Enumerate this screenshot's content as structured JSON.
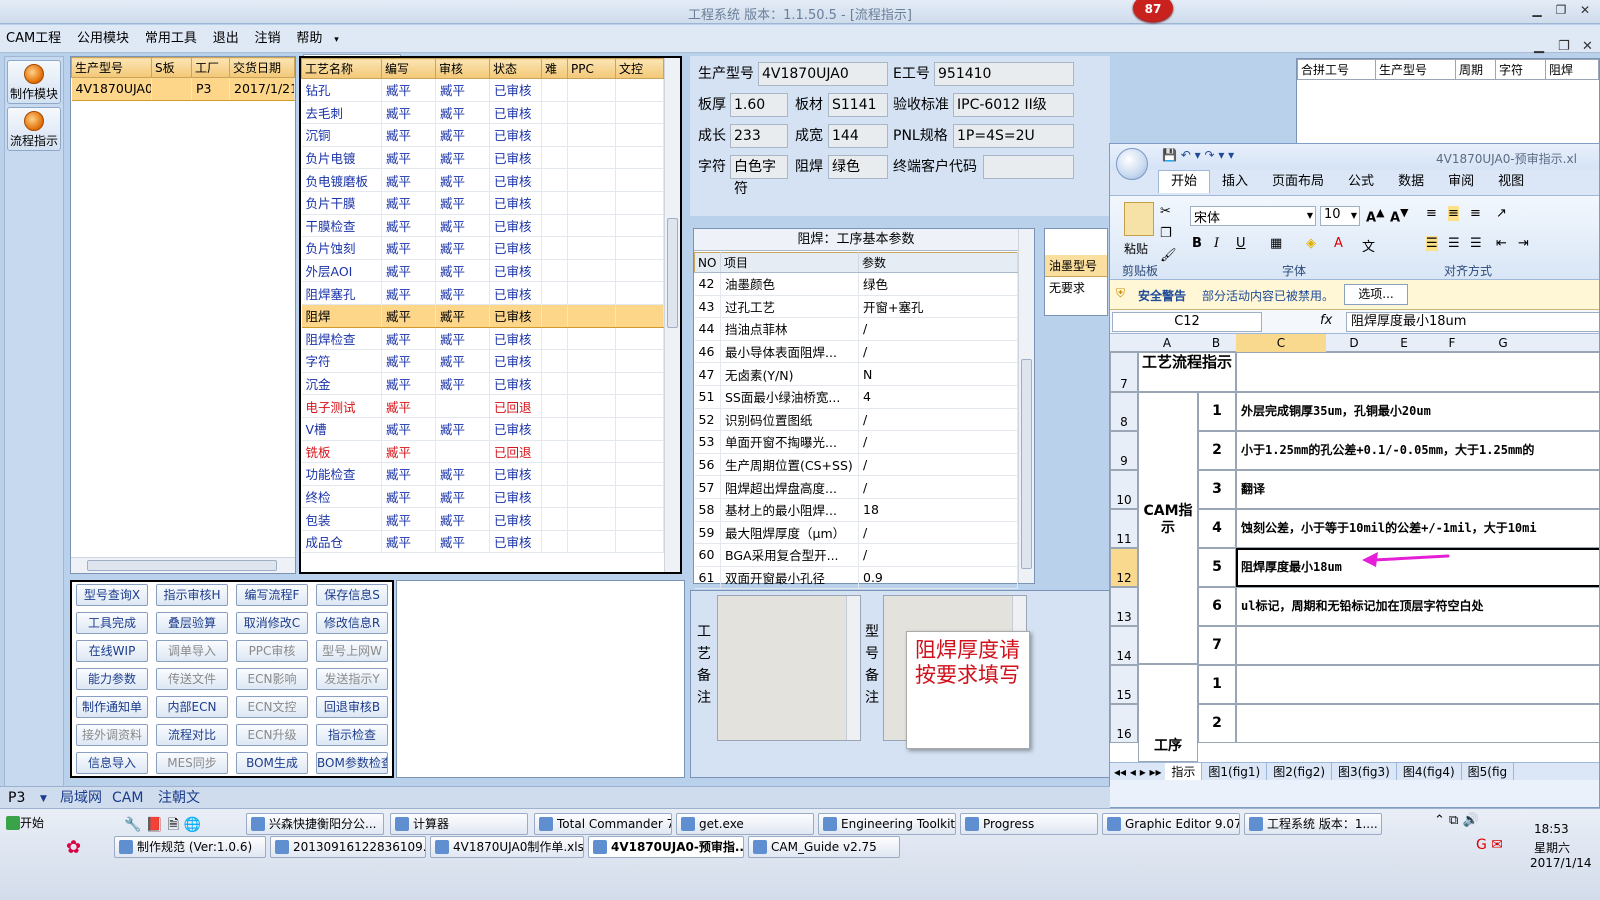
{
  "window": {
    "title": "工程系统  版本：1.1.50.5 - [流程指示]",
    "badge": "87"
  },
  "menu": {
    "items": [
      "CAM工程",
      "公用模块",
      "常用工具",
      "退出",
      "注销",
      "帮助"
    ],
    "combo_value": ""
  },
  "left_nav": {
    "items": [
      "制作模块",
      "流程指示"
    ]
  },
  "order_table": {
    "headers": [
      "生产型号",
      "S板",
      "工厂",
      "交货日期"
    ],
    "rows": [
      [
        "4V1870UJA0",
        "",
        "P3",
        "2017/1/21"
      ]
    ]
  },
  "process_table": {
    "headers": [
      "工艺名称",
      "编写",
      "审核",
      "状态",
      "难",
      "PPC",
      "文控"
    ],
    "rows": [
      [
        "钻孔",
        "臧平",
        "臧平",
        "已审核"
      ],
      [
        "去毛刺",
        "臧平",
        "臧平",
        "已审核"
      ],
      [
        "沉铜",
        "臧平",
        "臧平",
        "已审核"
      ],
      [
        "负片电镀",
        "臧平",
        "臧平",
        "已审核"
      ],
      [
        "负电镀磨板",
        "臧平",
        "臧平",
        "已审核"
      ],
      [
        "负片干膜",
        "臧平",
        "臧平",
        "已审核"
      ],
      [
        "干膜检查",
        "臧平",
        "臧平",
        "已审核"
      ],
      [
        "负片蚀刻",
        "臧平",
        "臧平",
        "已审核"
      ],
      [
        "外层AOI",
        "臧平",
        "臧平",
        "已审核"
      ],
      [
        "阻焊塞孔",
        "臧平",
        "臧平",
        "已审核"
      ],
      [
        "阻焊",
        "臧平",
        "臧平",
        "已审核"
      ],
      [
        "阻焊检查",
        "臧平",
        "臧平",
        "已审核"
      ],
      [
        "字符",
        "臧平",
        "臧平",
        "已审核"
      ],
      [
        "沉金",
        "臧平",
        "臧平",
        "已审核"
      ],
      [
        "电子测试",
        "臧平",
        "",
        "已回退"
      ],
      [
        "V槽",
        "臧平",
        "臧平",
        "已审核"
      ],
      [
        "铣板",
        "臧平",
        "",
        "已回退"
      ],
      [
        "功能检查",
        "臧平",
        "臧平",
        "已审核"
      ],
      [
        "终检",
        "臧平",
        "臧平",
        "已审核"
      ],
      [
        "包装",
        "臧平",
        "臧平",
        "已审核"
      ],
      [
        "成品仓",
        "臧平",
        "臧平",
        "已审核"
      ]
    ],
    "selected_index": 10,
    "red_indices": [
      14,
      16
    ]
  },
  "buttons": [
    [
      "型号查询X",
      "指示审核H",
      "编写流程F",
      "保存信息S"
    ],
    [
      "工具完成",
      "叠层验算",
      "取消修改C",
      "修改信息R"
    ],
    [
      "在线WIP",
      "调单导入",
      "PPC审核",
      "型号上网W"
    ],
    [
      "能力参数",
      "传送文件",
      "ECN影响",
      "发送指示Y"
    ],
    [
      "制作通知单",
      "内部ECN",
      "ECN文控",
      "回退审核B"
    ],
    [
      "接外调资料",
      "流程对比",
      "ECN升级",
      "指示检查"
    ],
    [
      "信息导入",
      "MES同步",
      "BOM生成",
      "BOM参数检查"
    ]
  ],
  "disabled_buttons": [
    "调单导入",
    "PPC审核",
    "型号上网W",
    "传送文件",
    "ECN影响",
    "发送指示Y",
    "ECN文控",
    "接外调资料",
    "ECN升级",
    "MES同步"
  ],
  "info": {
    "prod_model_label": "生产型号",
    "prod_model": "4V1870UJA0",
    "e_no_label": "E工号",
    "e_no": "951410",
    "thickness_label": "板厚",
    "thickness": "1.60",
    "material_label": "板材",
    "material": "S1141",
    "standard_label": "验收标准",
    "standard": "IPC-6012 II级",
    "length_label": "成长",
    "length": "233",
    "width_label": "成宽",
    "width": "144",
    "pnl_label": "PNL规格",
    "pnl": "1P=4S=2U",
    "char_label": "字符",
    "char": "白色字符",
    "mask_label": "阻焊",
    "mask": "绿色",
    "customer_label": "终端客户代码",
    "customer": ""
  },
  "merge_table": {
    "headers": [
      "合拼工号",
      "生产型号",
      "周期",
      "字符",
      "阻焊"
    ]
  },
  "params": {
    "title": "阻焊：工序基本参数",
    "headers": [
      "NO",
      "项目",
      "参数"
    ],
    "rows": [
      [
        "42",
        "油墨颜色",
        "绿色"
      ],
      [
        "43",
        "过孔工艺",
        "开窗+塞孔"
      ],
      [
        "44",
        "挡油点菲林",
        "/"
      ],
      [
        "46",
        "最小导体表面阻焊...",
        "/"
      ],
      [
        "47",
        "无卤素(Y/N)",
        "N"
      ],
      [
        "51",
        "SS面最小绿油桥宽...",
        "4"
      ],
      [
        "52",
        "识别码位置图纸",
        "/"
      ],
      [
        "53",
        "单面开窗不掏曝光...",
        "/"
      ],
      [
        "56",
        "生产周期位置(CS+SS)",
        "/"
      ],
      [
        "57",
        "阻焊超出焊盘高度...",
        "/"
      ],
      [
        "58",
        "基材上的最小阻焊...",
        "18"
      ],
      [
        "59",
        "最大阻焊厚度（μm）",
        "/"
      ],
      [
        "60",
        "BGA采用复合型开...",
        "/"
      ],
      [
        "61",
        "双面开窗最小孔径",
        "0.9"
      ]
    ]
  },
  "ink": {
    "header": "油墨型号",
    "value": "无要求"
  },
  "remarks": {
    "process_label": "工艺备注",
    "model_label": "型号备注"
  },
  "note": {
    "text": "阻焊厚度请按要求填写",
    "color": "#d0111b"
  },
  "excel": {
    "title": "4V1870UJA0-预审指示.xl",
    "tabs": [
      "开始",
      "插入",
      "页面布局",
      "公式",
      "数据",
      "审阅",
      "视图"
    ],
    "font_name": "宋体",
    "font_size": "10",
    "groups": [
      "剪贴板",
      "字体",
      "对齐方式"
    ],
    "paste_label": "粘贴",
    "security_label": "安全警告",
    "security_msg": "部分活动内容已被禁用。",
    "options_btn": "选项...",
    "cell_ref": "C12",
    "formula": "阻焊厚度最小18um",
    "columns": [
      "A",
      "B",
      "C",
      "D",
      "E",
      "F",
      "G"
    ],
    "section1": "工艺流程指示",
    "section2": "CAM指示",
    "section3": "工序",
    "rows": [
      {
        "r": "8",
        "n": "1",
        "t": "外层完成铜厚35um，孔铜最小20um"
      },
      {
        "r": "9",
        "n": "2",
        "t": "小于1.25mm的孔公差+0.1/-0.05mm，大于1.25mm的"
      },
      {
        "r": "10",
        "n": "3",
        "t": "翻译"
      },
      {
        "r": "11",
        "n": "4",
        "t": "蚀刻公差，小于等于10mil的公差+/-1mil，大于10mi"
      },
      {
        "r": "12",
        "n": "5",
        "t": "阻焊厚度最小18um"
      },
      {
        "r": "13",
        "n": "6",
        "t": "ul标记，周期和无铅标记加在顶层字符空白处"
      },
      {
        "r": "14",
        "n": "7",
        "t": ""
      },
      {
        "r": "15",
        "n": "1",
        "t": ""
      },
      {
        "r": "16",
        "n": "2",
        "t": ""
      }
    ],
    "sheet_tabs": [
      "指示",
      "图1(fig1)",
      "图2(fig2)",
      "图3(fig3)",
      "图4(fig4)",
      "图5(fig"
    ],
    "arrow_color": "#e41fd6"
  },
  "statusbar": {
    "site": "P3",
    "items": [
      "局域网",
      "CAM",
      "注朝文"
    ]
  },
  "taskbar": {
    "start": "开始",
    "row1": [
      "兴森快捷衡阳分公...",
      "计算器",
      "Total Commander 7.0...",
      "get.exe",
      "Engineering Toolkit 9....",
      "Progress",
      "Graphic Editor 9.07b...",
      "工程系统  版本：1...."
    ],
    "row2": [
      "制作规范 (Ver:1.0.6)",
      "20130916122836109.rtf...",
      "4V1870UJA0制作单.xls",
      "4V1870UJA0-预审指...",
      "CAM_Guide v2.75"
    ],
    "time": "18:53",
    "weekday": "星期六",
    "date": "2017/1/14"
  }
}
